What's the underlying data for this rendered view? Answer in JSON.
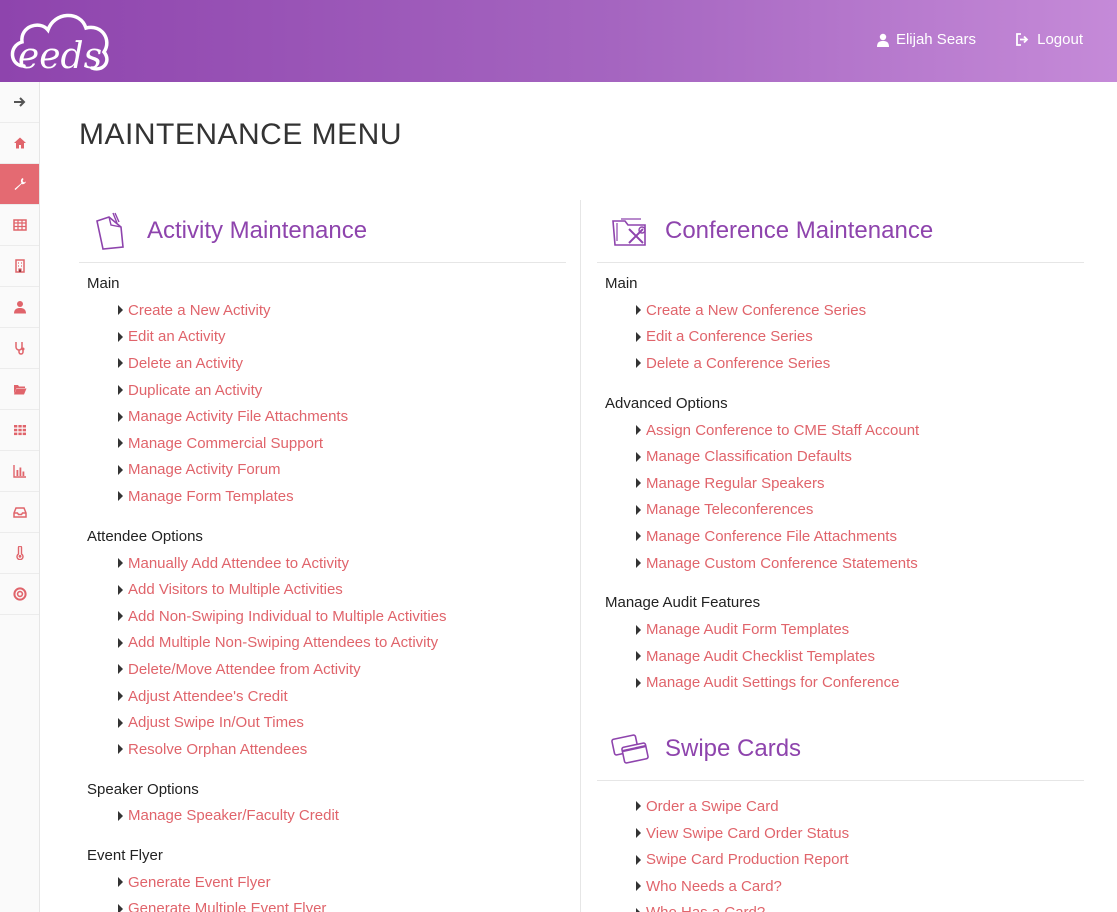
{
  "header": {
    "logo_text": "eeds",
    "user_name": "Elijah Sears",
    "logout_label": "Logout"
  },
  "sidebar": {
    "items": [
      {
        "icon": "arrow-right-icon",
        "active": false
      },
      {
        "icon": "home-icon",
        "active": false
      },
      {
        "icon": "wrench-icon",
        "active": true
      },
      {
        "icon": "table-icon",
        "active": false
      },
      {
        "icon": "building-icon",
        "active": false
      },
      {
        "icon": "user-doctor-icon",
        "active": false
      },
      {
        "icon": "stethoscope-icon",
        "active": false
      },
      {
        "icon": "folder-open-icon",
        "active": false
      },
      {
        "icon": "grid-icon",
        "active": false
      },
      {
        "icon": "bar-chart-icon",
        "active": false
      },
      {
        "icon": "inbox-icon",
        "active": false
      },
      {
        "icon": "thermometer-icon",
        "active": false
      },
      {
        "icon": "life-ring-icon",
        "active": false
      }
    ]
  },
  "page": {
    "title": "MAINTENANCE MENU"
  },
  "activity": {
    "title": "Activity Maintenance",
    "groups": [
      {
        "label": "Main",
        "links": [
          "Create a New Activity",
          "Edit an Activity",
          "Delete an Activity",
          "Duplicate an Activity",
          "Manage Activity File Attachments",
          "Manage Commercial Support",
          "Manage Activity Forum",
          "Manage Form Templates"
        ]
      },
      {
        "label": "Attendee Options",
        "links": [
          "Manually Add Attendee to Activity",
          "Add Visitors to Multiple Activities",
          "Add Non-Swiping Individual to Multiple Activities",
          "Add Multiple Non-Swiping Attendees to Activity",
          "Delete/Move Attendee from Activity",
          "Adjust Attendee's Credit",
          "Adjust Swipe In/Out Times",
          "Resolve Orphan Attendees"
        ]
      },
      {
        "label": "Speaker Options",
        "links": [
          "Manage Speaker/Faculty Credit"
        ]
      },
      {
        "label": "Event Flyer",
        "links": [
          "Generate Event Flyer",
          "Generate Multiple Event Flyer"
        ]
      }
    ]
  },
  "conference": {
    "title": "Conference Maintenance",
    "groups": [
      {
        "label": "Main",
        "links": [
          "Create a New Conference Series",
          "Edit a Conference Series",
          "Delete a Conference Series"
        ]
      },
      {
        "label": "Advanced Options",
        "links": [
          "Assign Conference to CME Staff Account",
          "Manage Classification Defaults",
          "Manage Regular Speakers",
          "Manage Teleconferences",
          "Manage Conference File Attachments",
          "Manage Custom Conference Statements"
        ]
      },
      {
        "label": "Manage Audit Features",
        "links": [
          "Manage Audit Form Templates",
          "Manage Audit Checklist Templates",
          "Manage Audit Settings for Conference"
        ]
      }
    ]
  },
  "swipe": {
    "title": "Swipe Cards",
    "links": [
      "Order a Swipe Card",
      "View Swipe Card Order Status",
      "Swipe Card Production Report",
      "Who Needs a Card?",
      "Who Has a Card?"
    ]
  },
  "colors": {
    "brand": "#8e44ad",
    "link": "#e0646b",
    "active_sidebar": "#e46a72"
  }
}
